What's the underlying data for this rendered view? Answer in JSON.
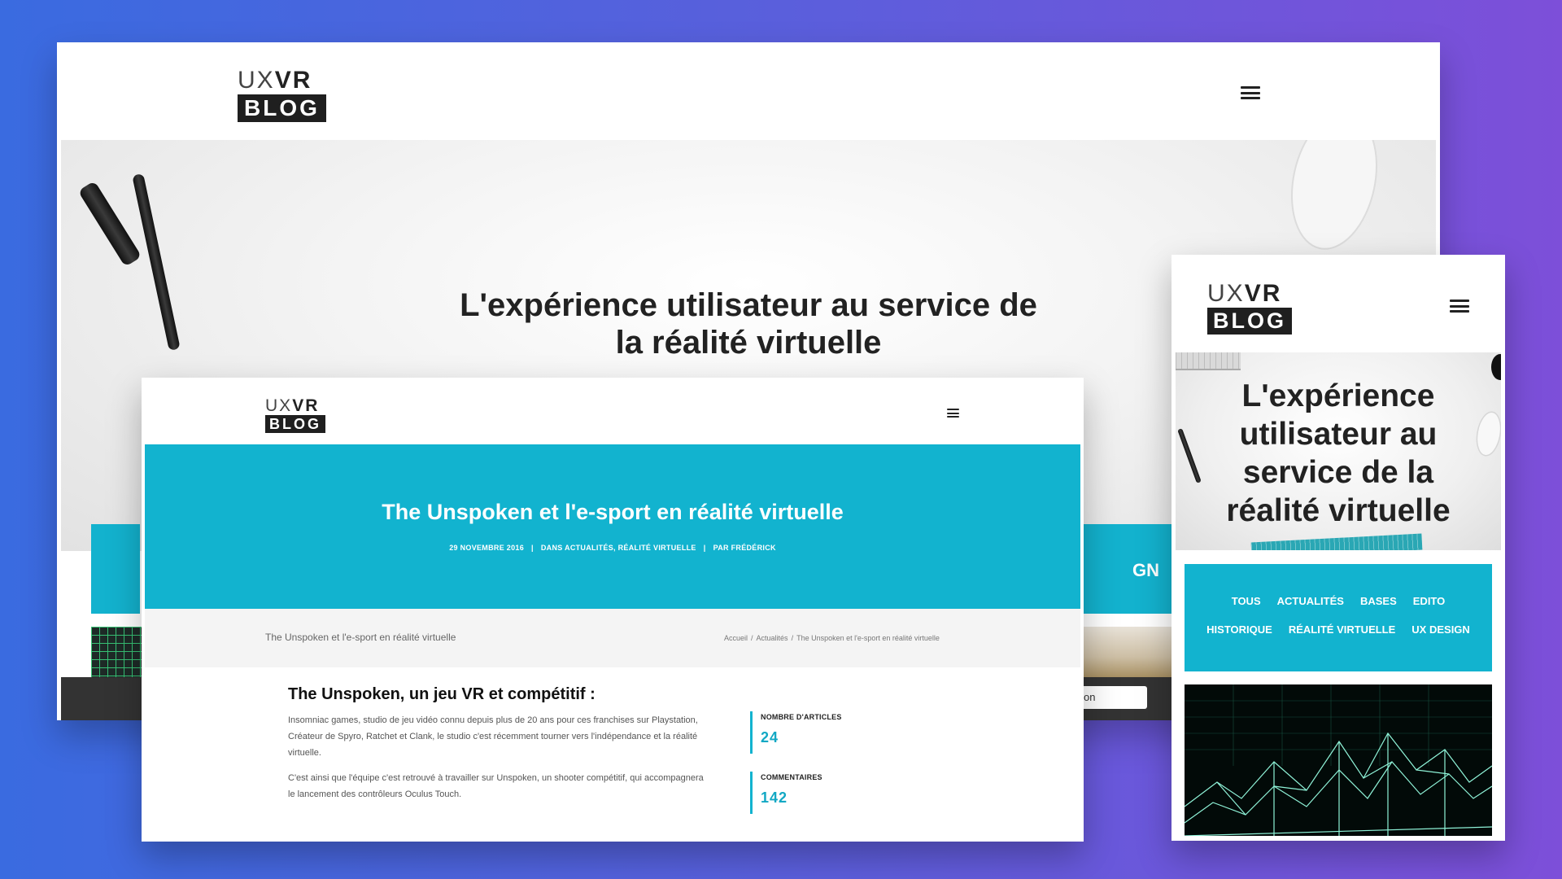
{
  "logo": {
    "top_thin": "UX",
    "top_bold": "VR",
    "box": "BLOG"
  },
  "desktop": {
    "hero_title_line1": "L'expérience utilisateur au service de",
    "hero_title_line2": "la réalité virtuelle",
    "partial_teal_text": "GN",
    "partial_button_text": "on"
  },
  "article": {
    "title": "The Unspoken et l'e-sport en réalité virtuelle",
    "meta": {
      "date": "29 NOVEMBRE 2016",
      "categories": "DANS ACTUALITÉS, RÉALITÉ VIRTUELLE",
      "author": "PAR FRÉDÉRICK",
      "separator": "|"
    },
    "crumb_title": "The Unspoken et l'e-sport en réalité virtuelle",
    "breadcrumbs": [
      "Accueil",
      "Actualités",
      "The Unspoken et l'e-sport en réalité virtuelle"
    ],
    "breadcrumb_separator": "/",
    "heading": "The Unspoken, un jeu VR et compétitif :",
    "paragraph1": "Insomniac games, studio de jeu vidéo connu depuis plus de 20 ans pour ces franchises sur Playstation, Créateur de Spyro, Ratchet et Clank, le studio c'est récemment tourner vers l'indépendance et la réalité virtuelle.",
    "paragraph2": "C'est ainsi que l'équipe c'est retrouvé à travailler sur Unspoken, un shooter compétitif, qui accompagnera le lancement des contrôleurs Oculus Touch.",
    "stats": [
      {
        "label": "NOMBRE D'ARTICLES",
        "value": "24"
      },
      {
        "label": "COMMENTAIRES",
        "value": "142"
      }
    ]
  },
  "mobile": {
    "hero_title_lines": [
      "L'expérience",
      "utilisateur au",
      "service de la",
      "réalité virtuelle"
    ],
    "categories_row1": [
      "TOUS",
      "ACTUALITÉS",
      "BASES",
      "EDITO"
    ],
    "categories_row2": [
      "HISTORIQUE",
      "RÉALITÉ VIRTUELLE",
      "UX DESIGN"
    ]
  },
  "colors": {
    "accent_teal": "#12b3cf",
    "background_gradient_start": "#3a6be0",
    "background_gradient_end": "#7d4fd9",
    "text_dark": "#222222"
  },
  "icons": [
    "hamburger-menu-icon",
    "pen-icon",
    "mouse-icon",
    "keyboard-icon",
    "wireframe-mountain-image"
  ]
}
